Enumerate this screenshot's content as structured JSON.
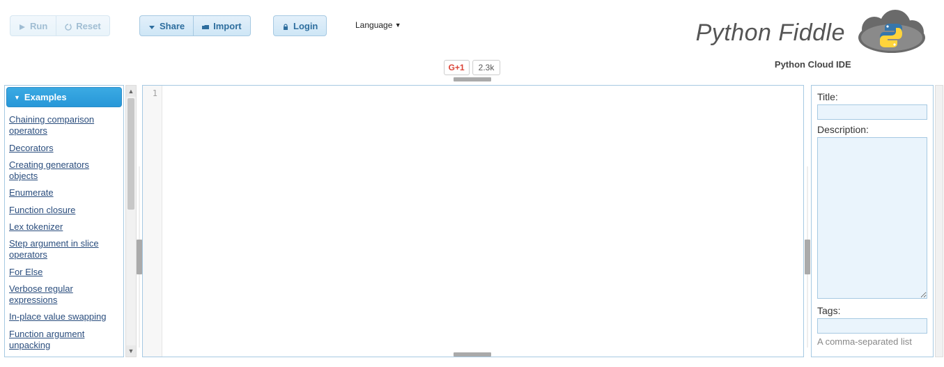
{
  "toolbar": {
    "run": "Run",
    "reset": "Reset",
    "share": "Share",
    "import": "Import",
    "login": "Login"
  },
  "language": {
    "label": "Language"
  },
  "brand": {
    "title": "Python Fiddle",
    "subtitle": "Python Cloud IDE"
  },
  "gplus": {
    "label": "+1",
    "count": "2.3k"
  },
  "sidebar": {
    "header": "Examples",
    "items": [
      "Chaining comparison operators",
      "Decorators",
      "Creating generators objects",
      "Enumerate",
      "Function closure",
      "Lex tokenizer",
      "Step argument in slice operators",
      "For Else",
      "Verbose regular expressions",
      "In-place value swapping",
      "Function argument unpacking"
    ]
  },
  "editor": {
    "line1": "1"
  },
  "meta": {
    "title_label": "Title:",
    "title_value": "",
    "desc_label": "Description:",
    "desc_value": "",
    "tags_label": "Tags:",
    "tags_value": "",
    "tags_hint": "A comma-separated list"
  }
}
